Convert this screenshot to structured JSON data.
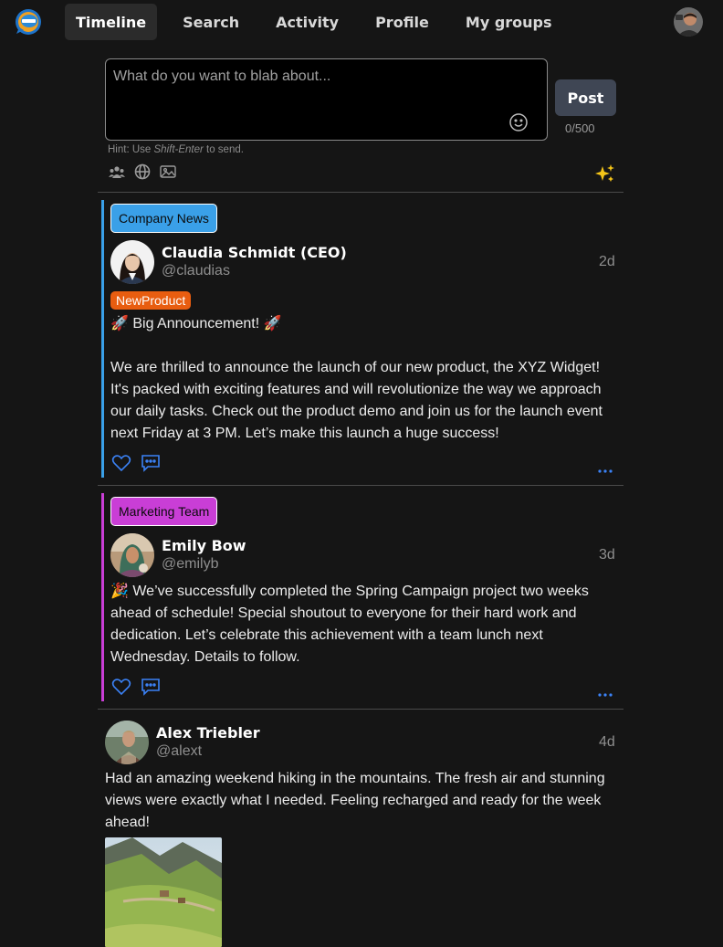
{
  "nav": {
    "items": [
      {
        "label": "Timeline",
        "active": true
      },
      {
        "label": "Search"
      },
      {
        "label": "Activity"
      },
      {
        "label": "Profile"
      },
      {
        "label": "My groups"
      }
    ]
  },
  "composer": {
    "placeholder": "What do you want to blab about...",
    "post_label": "Post",
    "counter": "0/500",
    "hint_prefix": "Hint: Use ",
    "hint_key": "Shift-Enter",
    "hint_suffix": " to send."
  },
  "posts": [
    {
      "group": "Company News",
      "group_color": "#3aa0e8",
      "name": "Claudia Schmidt (CEO)",
      "handle": "@claudias",
      "time": "2d",
      "hashtag": "NewProduct",
      "body_line1": "🚀 Big Announcement! 🚀",
      "body": "We are thrilled to announce the launch of our new product, the XYZ Widget! It's packed with exciting features and will revolutionize the way we approach our daily tasks. Check out the product demo and join us for the launch event next Friday at 3 PM. Let’s make this launch a huge success!"
    },
    {
      "group": "Marketing Team",
      "group_color": "#c93ed6",
      "name": "Emily Bow",
      "handle": "@emilyb",
      "time": "3d",
      "body": "🎉 We’ve successfully completed the Spring Campaign project two weeks ahead of schedule! Special shoutout to everyone for their hard work and dedication. Let’s celebrate this achievement with a team lunch next Wednesday. Details to follow."
    },
    {
      "name": "Alex Triebler",
      "handle": "@alext",
      "time": "4d",
      "body": "Had an amazing weekend hiking in the mountains. The fresh air and stunning views were exactly what I needed. Feeling recharged and ready for the week ahead!"
    }
  ],
  "colors": {
    "accent": "#3b82f6",
    "sparkle": "#f5c518"
  }
}
